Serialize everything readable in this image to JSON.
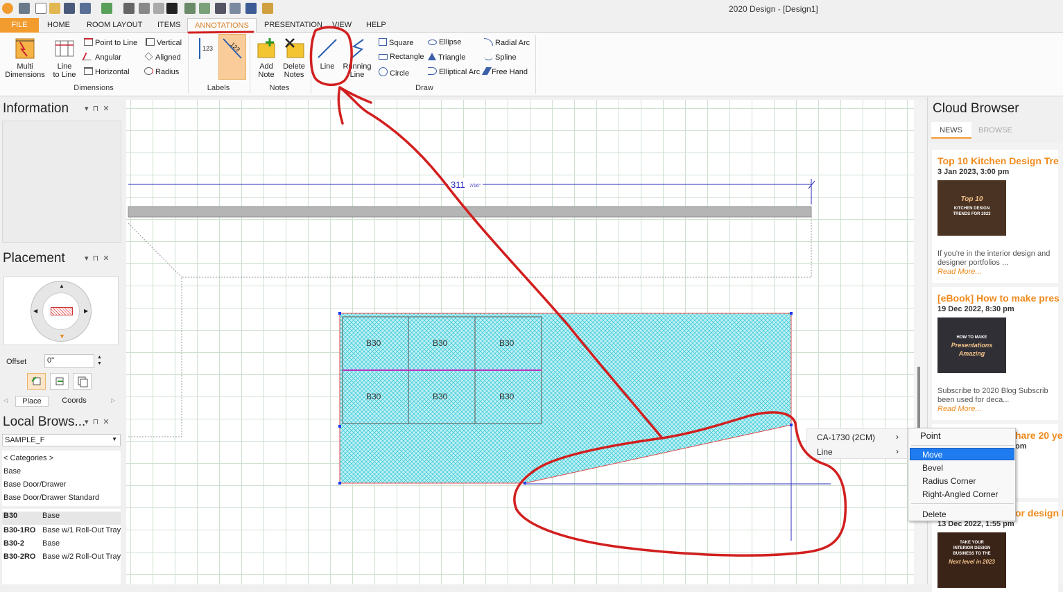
{
  "app": {
    "title": "2020 Design - [Design1]"
  },
  "tabs": [
    {
      "label": "FILE"
    },
    {
      "label": "HOME"
    },
    {
      "label": "ROOM LAYOUT"
    },
    {
      "label": "ITEMS"
    },
    {
      "label": "ANNOTATIONS"
    },
    {
      "label": "PRESENTATION"
    },
    {
      "label": "VIEW"
    },
    {
      "label": "HELP"
    }
  ],
  "ribbon": {
    "dimensions": {
      "label": "Dimensions",
      "multi_line1": "Multi",
      "multi_line2": "Dimensions",
      "line_line1": "Line",
      "line_line2": "to Line",
      "point_to_line": "Point to Line",
      "angular": "Angular",
      "horizontal": "Horizontal",
      "vertical": "Vertical",
      "aligned": "Aligned",
      "radius": "Radius"
    },
    "labels": {
      "label": "Labels"
    },
    "notes": {
      "label": "Notes",
      "add1": "Add",
      "add2": "Note",
      "del1": "Delete",
      "del2": "Notes"
    },
    "draw": {
      "label": "Draw",
      "line": "Line",
      "running1": "Running",
      "running2": "Line",
      "square": "Square",
      "rectangle": "Rectangle",
      "circle": "Circle",
      "ellipse": "Ellipse",
      "triangle": "Triangle",
      "elliptical_arc": "Elliptical Arc",
      "radial_arc": "Radial Arc",
      "spline": "Spline",
      "free_hand": "Free Hand"
    }
  },
  "left_panel": {
    "information": {
      "title": "Information"
    },
    "placement": {
      "title": "Placement",
      "offset_label": "Offset",
      "offset_value": "0\"",
      "tab_place": "Place",
      "tab_coords": "Coords"
    },
    "local_browser": {
      "title": "Local Brows...",
      "catalog": "SAMPLE_F",
      "categories_label": "< Categories >",
      "categories": [
        "Base",
        "Base Door/Drawer",
        "Base Door/Drawer Standard"
      ],
      "items": [
        {
          "code": "B30",
          "desc": "Base"
        },
        {
          "code": "B30-1RO",
          "desc": "Base w/1 Roll-Out Tray"
        },
        {
          "code": "B30-2",
          "desc": "Base"
        },
        {
          "code": "B30-2RO",
          "desc": "Base w/2 Roll-Out Tray"
        }
      ]
    }
  },
  "canvas": {
    "dimension_text": "311",
    "dimension_fraction": "7/16\"",
    "cabinet_labels": [
      "B30",
      "B30",
      "B30",
      "B30",
      "B30",
      "B30"
    ]
  },
  "right_panel": {
    "title": "Cloud Browser",
    "tab_news": "NEWS",
    "tab_browse": "BROWSE",
    "cards": [
      {
        "title": "Top 10 Kitchen Design Tre",
        "date": "3 Jan 2023, 3:00 pm",
        "img_line1": "Top 10",
        "img_line2": "KITCHEN DESIGN",
        "img_line3": "TRENDS FOR 2023",
        "text1": "If you're in the interior design and",
        "text2": "designer portfolios ...",
        "more": "Read More..."
      },
      {
        "title": "[eBook] How to make pres",
        "date": "19 Dec 2022, 8:30 pm",
        "img_line1": "HOW TO MAKE",
        "img_line2": "Presentations",
        "img_line3": "Amazing",
        "text1": "Subscribe to 2020 Blog Subscrib",
        "text2": "been used for deca...",
        "more": "Read More..."
      },
      {
        "title": "hare 20 yea",
        "date": "om"
      },
      {
        "title": "or design I",
        "date": "13 Dec 2022, 1:55 pm",
        "img_line1": "TAKE YOUR",
        "img_line2": "INTERIOR DESIGN",
        "img_line3": "BUSINESS TO THE",
        "img_line4": "Next level in 2023"
      }
    ]
  },
  "context_menu": {
    "items": [
      {
        "label": "CA-1730 (2CM)"
      },
      {
        "label": "Line"
      }
    ],
    "submenu": [
      {
        "label": "Point"
      },
      {
        "label": "Move"
      },
      {
        "label": "Bevel"
      },
      {
        "label": "Radius Corner"
      },
      {
        "label": "Right-Angled Corner"
      },
      {
        "label": "Delete"
      }
    ]
  },
  "colors": {
    "accent": "#f29b2f",
    "annotation_red": "#d21f1f",
    "hatch": "#2ec6d6",
    "selection": "#1e7cf0"
  }
}
